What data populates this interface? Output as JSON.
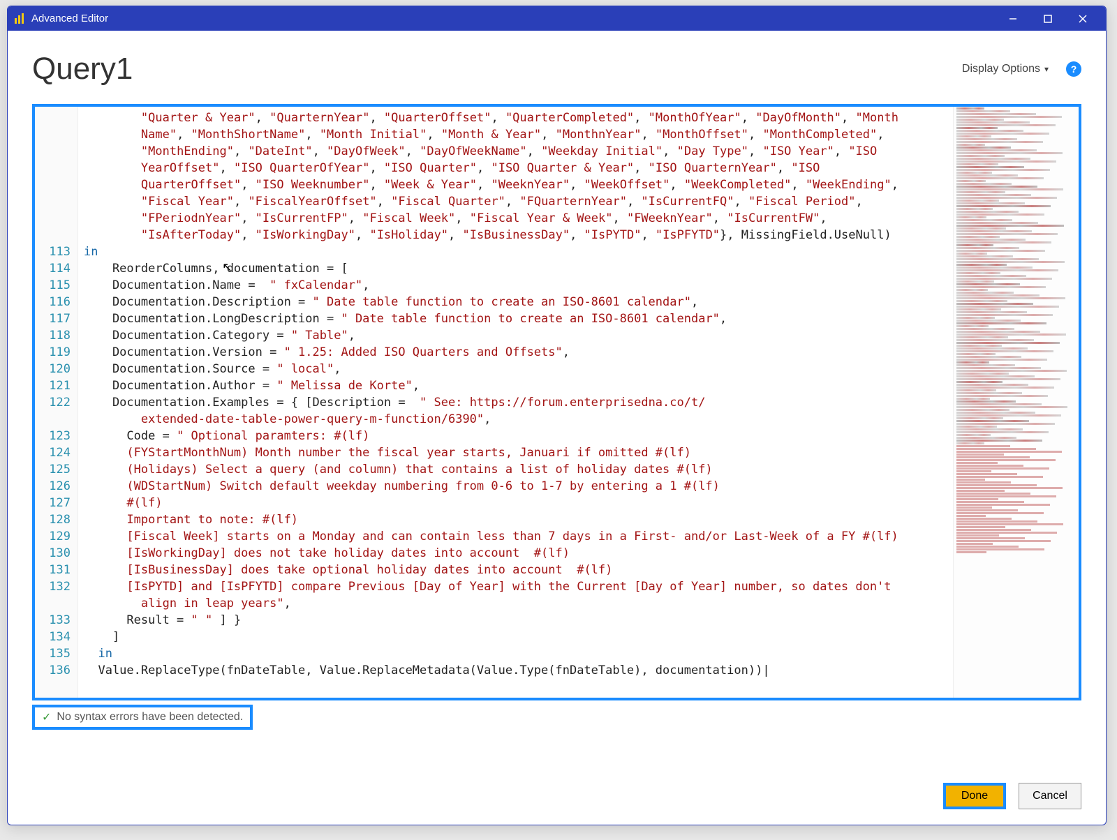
{
  "window": {
    "title": "Advanced Editor"
  },
  "header": {
    "query_name": "Query1",
    "display_options": "Display Options",
    "help_tooltip": "?"
  },
  "status": {
    "message": "No syntax errors have been detected."
  },
  "buttons": {
    "done": "Done",
    "cancel": "Cancel"
  },
  "code": {
    "gutter_start_blank_lines": 8,
    "line_numbers": [
      113,
      114,
      115,
      116,
      117,
      118,
      119,
      120,
      121,
      122,
      123,
      124,
      125,
      126,
      127,
      128,
      129,
      130,
      131,
      132,
      133,
      134,
      135,
      136
    ],
    "prelude_strings_lines": [
      [
        "\"Quarter & Year\"",
        ", ",
        "\"QuarternYear\"",
        ", ",
        "\"QuarterOffset\"",
        ", ",
        "\"QuarterCompleted\"",
        ", ",
        "\"MonthOfYear\"",
        ", ",
        "\"DayOfMonth\"",
        ", ",
        "\"Month"
      ],
      [
        "Name\"",
        ", ",
        "\"MonthShortName\"",
        ", ",
        "\"Month Initial\"",
        ", ",
        "\"Month & Year\"",
        ", ",
        "\"MonthnYear\"",
        ", ",
        "\"MonthOffset\"",
        ", ",
        "\"MonthCompleted\"",
        ","
      ],
      [
        "\"MonthEnding\"",
        ", ",
        "\"DateInt\"",
        ", ",
        "\"DayOfWeek\"",
        ", ",
        "\"DayOfWeekName\"",
        ", ",
        "\"Weekday Initial\"",
        ", ",
        "\"Day Type\"",
        ", ",
        "\"ISO Year\"",
        ", ",
        "\"ISO"
      ],
      [
        "YearOffset\"",
        ", ",
        "\"ISO QuarterOfYear\"",
        ", ",
        "\"ISO Quarter\"",
        ", ",
        "\"ISO Quarter & Year\"",
        ", ",
        "\"ISO QuarternYear\"",
        ", ",
        "\"ISO"
      ],
      [
        "QuarterOffset\"",
        ", ",
        "\"ISO Weeknumber\"",
        ", ",
        "\"Week & Year\"",
        ", ",
        "\"WeeknYear\"",
        ", ",
        "\"WeekOffset\"",
        ", ",
        "\"WeekCompleted\"",
        ", ",
        "\"WeekEnding\"",
        ","
      ],
      [
        "\"Fiscal Year\"",
        ", ",
        "\"FiscalYearOffset\"",
        ", ",
        "\"Fiscal Quarter\"",
        ", ",
        "\"FQuarternYear\"",
        ", ",
        "\"IsCurrentFQ\"",
        ", ",
        "\"Fiscal Period\"",
        ","
      ],
      [
        "\"FPeriodnYear\"",
        ", ",
        "\"IsCurrentFP\"",
        ", ",
        "\"Fiscal Week\"",
        ", ",
        "\"Fiscal Year & Week\"",
        ", ",
        "\"FWeeknYear\"",
        ", ",
        "\"IsCurrentFW\"",
        ","
      ],
      [
        "\"IsAfterToday\"",
        ", ",
        "\"IsWorkingDay\"",
        ", ",
        "\"IsHoliday\"",
        ", ",
        "\"IsBusinessDay\"",
        ", ",
        "\"IsPYTD\"",
        ", ",
        "\"IsPFYTD\"",
        "}, MissingField.UseNull)"
      ]
    ],
    "body_lines": [
      {
        "n": 113,
        "segs": [
          {
            "t": "in",
            "c": "kw"
          }
        ]
      },
      {
        "n": 114,
        "segs": [
          {
            "t": "    ReorderColumns, documentation = [",
            "c": "nm"
          }
        ]
      },
      {
        "n": 115,
        "segs": [
          {
            "t": "    Documentation.Name = ",
            "c": "nm"
          },
          {
            "t": " \" fxCalendar\"",
            "c": "str"
          },
          {
            "t": ",",
            "c": "nm"
          }
        ]
      },
      {
        "n": 116,
        "segs": [
          {
            "t": "    Documentation.Description = ",
            "c": "nm"
          },
          {
            "t": "\" Date table function to create an ISO-8601 calendar\"",
            "c": "str"
          },
          {
            "t": ",",
            "c": "nm"
          }
        ]
      },
      {
        "n": 117,
        "segs": [
          {
            "t": "    Documentation.LongDescription = ",
            "c": "nm"
          },
          {
            "t": "\" Date table function to create an ISO-8601 calendar\"",
            "c": "str"
          },
          {
            "t": ",",
            "c": "nm"
          }
        ]
      },
      {
        "n": 118,
        "segs": [
          {
            "t": "    Documentation.Category = ",
            "c": "nm"
          },
          {
            "t": "\" Table\"",
            "c": "str"
          },
          {
            "t": ",",
            "c": "nm"
          }
        ]
      },
      {
        "n": 119,
        "segs": [
          {
            "t": "    Documentation.Version = ",
            "c": "nm"
          },
          {
            "t": "\" 1.25: Added ISO Quarters and Offsets\"",
            "c": "str"
          },
          {
            "t": ",",
            "c": "nm"
          }
        ]
      },
      {
        "n": 120,
        "segs": [
          {
            "t": "    Documentation.Source = ",
            "c": "nm"
          },
          {
            "t": "\" local\"",
            "c": "str"
          },
          {
            "t": ",",
            "c": "nm"
          }
        ]
      },
      {
        "n": 121,
        "segs": [
          {
            "t": "    Documentation.Author = ",
            "c": "nm"
          },
          {
            "t": "\" Melissa de Korte\"",
            "c": "str"
          },
          {
            "t": ",",
            "c": "nm"
          }
        ]
      },
      {
        "n": 122,
        "segs": [
          {
            "t": "    Documentation.Examples = { [Description =  ",
            "c": "nm"
          },
          {
            "t": "\" See: https://forum.enterprisedna.co/t/",
            "c": "str"
          }
        ]
      },
      {
        "n": null,
        "segs": [
          {
            "t": "        extended-date-table-power-query-m-function/6390\"",
            "c": "str"
          },
          {
            "t": ",",
            "c": "nm"
          }
        ]
      },
      {
        "n": 123,
        "segs": [
          {
            "t": "      Code = ",
            "c": "nm"
          },
          {
            "t": "\" Optional paramters: #(lf)",
            "c": "str"
          }
        ]
      },
      {
        "n": 124,
        "segs": [
          {
            "t": "      (FYStartMonthNum) Month number the fiscal year starts, Januari if omitted #(lf)",
            "c": "str"
          }
        ]
      },
      {
        "n": 125,
        "segs": [
          {
            "t": "      (Holidays) Select a query (and column) that contains a list of holiday dates #(lf)",
            "c": "str"
          }
        ]
      },
      {
        "n": 126,
        "segs": [
          {
            "t": "      (WDStartNum) Switch default weekday numbering from 0-6 to 1-7 by entering a 1 #(lf)",
            "c": "str"
          }
        ]
      },
      {
        "n": 127,
        "segs": [
          {
            "t": "      #(lf)",
            "c": "str"
          }
        ]
      },
      {
        "n": 128,
        "segs": [
          {
            "t": "      Important to note: #(lf)",
            "c": "str"
          }
        ]
      },
      {
        "n": 129,
        "segs": [
          {
            "t": "      [Fiscal Week] starts on a Monday and can contain less than 7 days in a First- and/or Last-Week of a FY #(lf)",
            "c": "str"
          }
        ]
      },
      {
        "n": 130,
        "segs": [
          {
            "t": "      [IsWorkingDay] does not take holiday dates into account  #(lf)",
            "c": "str"
          }
        ]
      },
      {
        "n": 131,
        "segs": [
          {
            "t": "      [IsBusinessDay] does take optional holiday dates into account  #(lf)",
            "c": "str"
          }
        ]
      },
      {
        "n": 132,
        "segs": [
          {
            "t": "      [IsPYTD] and [IsPFYTD] compare Previous [Day of Year] with the Current [Day of Year] number, so dates don't",
            "c": "str"
          }
        ]
      },
      {
        "n": null,
        "segs": [
          {
            "t": "        align in leap years\"",
            "c": "str"
          },
          {
            "t": ",",
            "c": "nm"
          }
        ]
      },
      {
        "n": 133,
        "segs": [
          {
            "t": "      Result = ",
            "c": "nm"
          },
          {
            "t": "\" \"",
            "c": "str"
          },
          {
            "t": " ] }",
            "c": "nm"
          }
        ]
      },
      {
        "n": 134,
        "segs": [
          {
            "t": "    ]",
            "c": "nm"
          }
        ]
      },
      {
        "n": 135,
        "segs": [
          {
            "t": "  in",
            "c": "kw"
          }
        ]
      },
      {
        "n": 136,
        "segs": [
          {
            "t": "  Value.ReplaceType(fnDateTable, Value.ReplaceMetadata(Value.Type(fnDateTable), documentation))",
            "c": "nm"
          },
          {
            "t": "|",
            "c": "nm"
          }
        ]
      }
    ]
  }
}
